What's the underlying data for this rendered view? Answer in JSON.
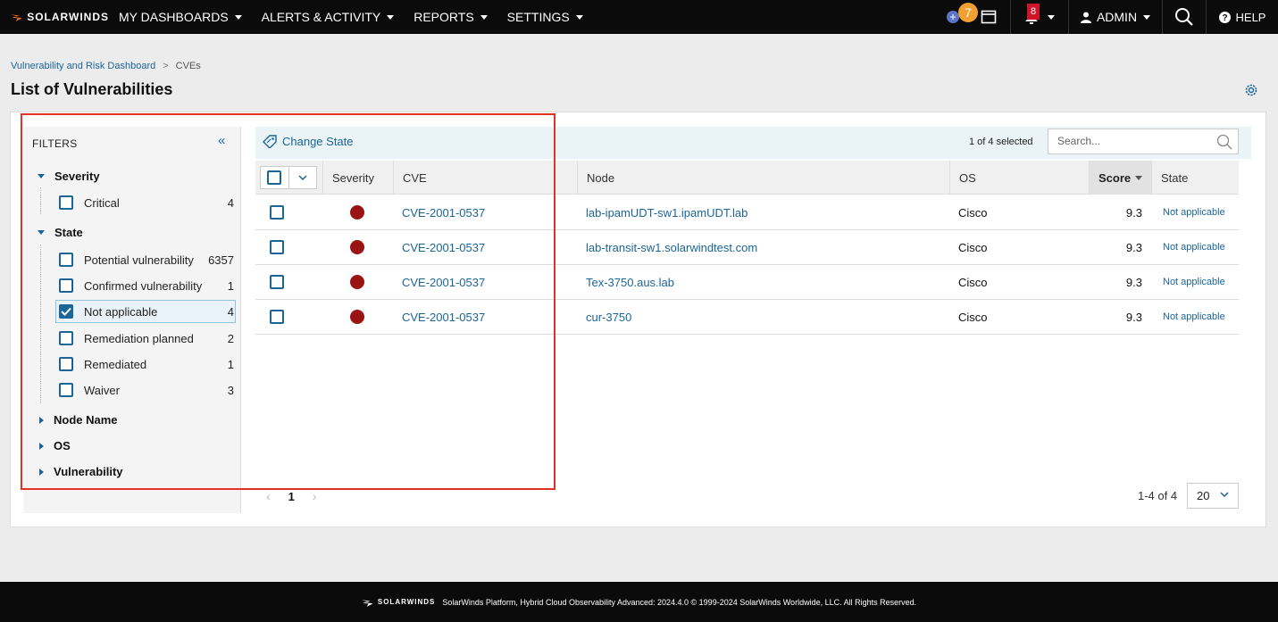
{
  "nav": {
    "brand": "SOLARWINDS",
    "menu": [
      "MY DASHBOARDS",
      "ALERTS & ACTIVITY",
      "REPORTS",
      "SETTINGS"
    ],
    "news_badge": "7",
    "alerts_badge": "8",
    "user": "ADMIN",
    "help": "HELP"
  },
  "breadcrumb": {
    "parent": "Vulnerability and Risk Dashboard",
    "separator": ">",
    "current": "CVEs"
  },
  "page": {
    "title": "List of Vulnerabilities"
  },
  "filters": {
    "title": "FILTERS",
    "severity": {
      "label": "Severity",
      "options": [
        {
          "label": "Critical",
          "count": "4"
        }
      ]
    },
    "state": {
      "label": "State",
      "options": [
        {
          "label": "Potential vulnerability",
          "count": "6357"
        },
        {
          "label": "Confirmed vulnerability",
          "count": "1"
        },
        {
          "label": "Not applicable",
          "count": "4"
        },
        {
          "label": "Remediation planned",
          "count": "2"
        },
        {
          "label": "Remediated",
          "count": "1"
        },
        {
          "label": "Waiver",
          "count": "3"
        }
      ]
    },
    "collapsed_groups": [
      "Node Name",
      "OS",
      "Vulnerability"
    ]
  },
  "toolbar": {
    "change_state": "Change State",
    "selected": "1 of 4 selected",
    "search_placeholder": "Search..."
  },
  "table": {
    "columns": [
      "Severity",
      "CVE",
      "Node",
      "OS",
      "Score",
      "State"
    ],
    "rows": [
      {
        "cve": "CVE-2001-0537",
        "node": "lab-ipamUDT-sw1.ipamUDT.lab",
        "os": "Cisco",
        "score": "9.3",
        "state": "Not applicable"
      },
      {
        "cve": "CVE-2001-0537",
        "node": "lab-transit-sw1.solarwindtest.com",
        "os": "Cisco",
        "score": "9.3",
        "state": "Not applicable"
      },
      {
        "cve": "CVE-2001-0537",
        "node": "Tex-3750.aus.lab",
        "os": "Cisco",
        "score": "9.3",
        "state": "Not applicable"
      },
      {
        "cve": "CVE-2001-0537",
        "node": "cur-3750",
        "os": "Cisco",
        "score": "9.3",
        "state": "Not applicable"
      }
    ]
  },
  "pagination": {
    "page": "1",
    "range": "1-4 of 4",
    "page_size": "20"
  },
  "footer": {
    "brand": "SOLARWINDS",
    "text": "SolarWinds Platform, Hybrid Cloud Observability Advanced: 2024.4.0 © 1999-2024 SolarWinds Worldwide, LLC. All Rights Reserved."
  },
  "colors": {
    "accent": "#1b6598",
    "critical": "#9a1414",
    "highlight": "#e03225",
    "news_badge": "#f0a030",
    "alert_badge": "#d0142a"
  }
}
